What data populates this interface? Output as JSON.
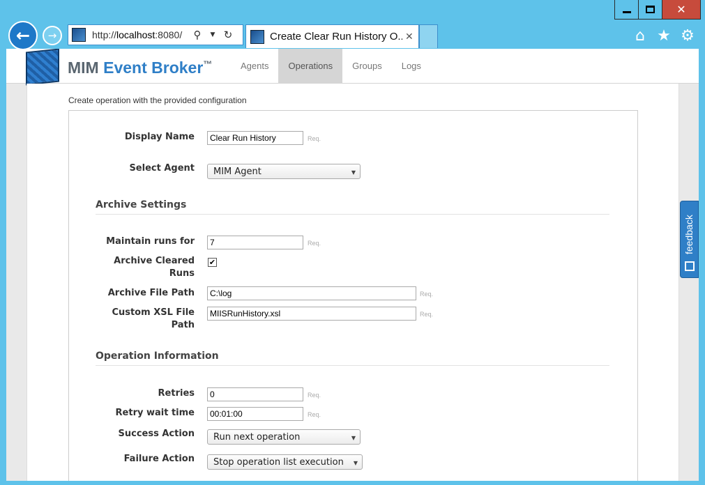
{
  "browser": {
    "url_prefix": "http://",
    "url_host": "localhost",
    "url_rest": ":8080/",
    "tab_title": "Create Clear Run History O...",
    "tab_close": "✕",
    "window_close": "✕"
  },
  "nav": {
    "brand_part1": "MIM ",
    "brand_part2": "Event Broker",
    "brand_tm": "™",
    "items": [
      {
        "label": "Agents"
      },
      {
        "label": "Operations"
      },
      {
        "label": "Groups"
      },
      {
        "label": "Logs"
      }
    ],
    "active": "Operations"
  },
  "page": {
    "subtitle": "Create operation with the provided configuration"
  },
  "form": {
    "display_name_label": "Display Name",
    "display_name_value": "Clear Run History",
    "select_agent_label": "Select Agent",
    "select_agent_value": "MIM Agent",
    "archive_section": "Archive Settings",
    "maintain_runs_label": "Maintain runs for",
    "maintain_runs_value": "7",
    "archive_cleared_label_1": "Archive Cleared",
    "archive_cleared_label_2": "Runs",
    "archive_cleared_checked": true,
    "archive_path_label": "Archive File Path",
    "archive_path_value": "C:\\log",
    "xsl_label_1": "Custom XSL File",
    "xsl_label_2": "Path",
    "xsl_value": "MIISRunHistory.xsl",
    "operation_section": "Operation Information",
    "retries_label": "Retries",
    "retries_value": "0",
    "retry_wait_label": "Retry wait time",
    "retry_wait_value": "00:01:00",
    "success_label": "Success Action",
    "success_value": "Run next operation",
    "failure_label": "Failure Action",
    "failure_value": "Stop operation list execution",
    "req": "Req."
  },
  "feedback": {
    "label": "feedback"
  }
}
